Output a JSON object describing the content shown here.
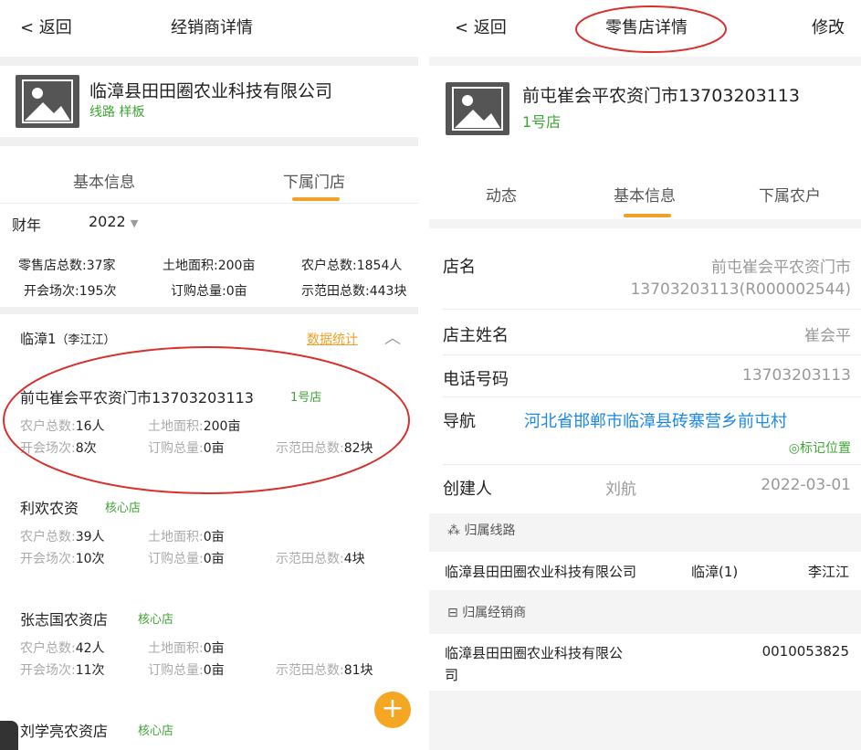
{
  "left": {
    "header": {
      "back_label": "< 返回",
      "title": "经销商详情"
    },
    "company": {
      "name": "临漳县田田圈农业科技有限公司",
      "tags": "线路 样板"
    },
    "tabs": [
      {
        "label": "基本信息"
      },
      {
        "label": "下属门店"
      }
    ],
    "fiscal_year": {
      "label": "财年",
      "value": "2022"
    },
    "stats": {
      "retail_count": "零售店总数:37家",
      "land_area": "土地面积:200亩",
      "farmer_count": "农户总数:1854人",
      "meetings": "开会场次:195次",
      "order_total": "订购总量:0亩",
      "demo_fields": "示范田总数:443块"
    },
    "group": {
      "name": "临漳1",
      "owner": "（李江江）",
      "stats_link": "数据统计"
    },
    "stores": [
      {
        "name": "前屯崔会平农资门市13703203113",
        "tag": "1号店",
        "farmers_k": "农户总数:",
        "farmers_v": "16人",
        "land_k": "土地面积:",
        "land_v": "200亩",
        "meetings_k": "开会场次:",
        "meetings_v": "8次",
        "order_k": "订购总量:",
        "order_v": "0亩",
        "demo_k": "示范田总数:",
        "demo_v": "82块"
      },
      {
        "name": "利欢农资",
        "tag": "核心店",
        "farmers_k": "农户总数:",
        "farmers_v": "39人",
        "land_k": "土地面积:",
        "land_v": "0亩",
        "meetings_k": "开会场次:",
        "meetings_v": "10次",
        "order_k": "订购总量:",
        "order_v": "0亩",
        "demo_k": "示范田总数:",
        "demo_v": "4块"
      },
      {
        "name": "张志国农资店",
        "tag": "核心店",
        "farmers_k": "农户总数:",
        "farmers_v": "42人",
        "land_k": "土地面积:",
        "land_v": "0亩",
        "meetings_k": "开会场次:",
        "meetings_v": "11次",
        "order_k": "订购总量:",
        "order_v": "0亩",
        "demo_k": "示范田总数:",
        "demo_v": "81块"
      },
      {
        "name": "刘学亮农资店",
        "tag": "核心店"
      }
    ],
    "fab_label": "+"
  },
  "right": {
    "header": {
      "back_label": "< 返回",
      "title": "零售店详情",
      "edit_label": "修改"
    },
    "store": {
      "name": "前屯崔会平农资门市13703203113",
      "tag": "1号店"
    },
    "tabs": [
      {
        "label": "动态"
      },
      {
        "label": "基本信息"
      },
      {
        "label": "下属农户"
      }
    ],
    "fields": {
      "shop_name_label": "店名",
      "shop_name_value_1": "前屯崔会平农资门市",
      "shop_name_value_2": "13703203113(R000002544)",
      "owner_label": "店主姓名",
      "owner_value": "崔会平",
      "phone_label": "电话号码",
      "phone_value": "13703203113",
      "nav_label": "导航",
      "nav_value": "河北省邯郸市临漳县砖寨营乡前屯村",
      "mark_location": "◎标记位置",
      "creator_label": "创建人",
      "creator_value": "刘航",
      "created_date": "2022-03-01"
    },
    "route_section": {
      "title": "归属线路",
      "company": "临漳县田田圈农业科技有限公司",
      "route": "临漳(1)",
      "person": "李江江"
    },
    "dealer_section": {
      "title": "归属经销商",
      "company_line1": "临漳县田田圈农业科技有限公",
      "company_line2": "司",
      "code": "0010053825"
    }
  },
  "colors": {
    "accent_orange": "#f0a127",
    "tag_green": "#3fa535",
    "link_blue": "#1e88e5",
    "annotation_red": "#d9302c"
  }
}
